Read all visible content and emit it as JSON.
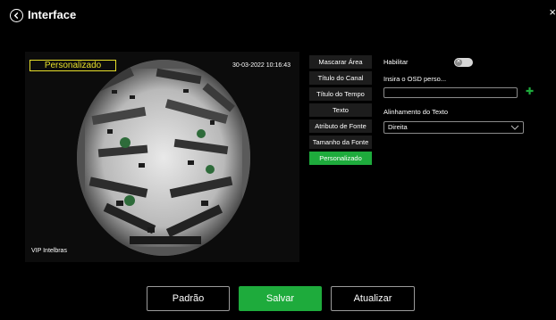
{
  "header": {
    "title": "Interface",
    "close_glyph": "×"
  },
  "video": {
    "osd_label": "Personalizado",
    "timestamp": "30-03-2022 10:16:43",
    "channel_name": "VIP Intelbras"
  },
  "menu": {
    "items": [
      {
        "label": "Mascarar Área",
        "active": false
      },
      {
        "label": "Título do Canal",
        "active": false
      },
      {
        "label": "Título do Tempo",
        "active": false
      },
      {
        "label": "Texto",
        "active": false
      },
      {
        "label": "Atributo de Fonte",
        "active": false
      },
      {
        "label": "Tamanho da Fonte",
        "active": false
      },
      {
        "label": "Personalizado",
        "active": true
      }
    ]
  },
  "panel": {
    "enable_label": "Habilitar",
    "enable_on": false,
    "osd_label": "Insira o OSD perso...",
    "osd_value": "",
    "align_label": "Alinhamento do Texto",
    "align_value": "Direita"
  },
  "footer": {
    "default_label": "Padrão",
    "save_label": "Salvar",
    "refresh_label": "Atualizar"
  },
  "colors": {
    "accent": "#1eab3c",
    "osd_yellow": "#e6df2a"
  }
}
